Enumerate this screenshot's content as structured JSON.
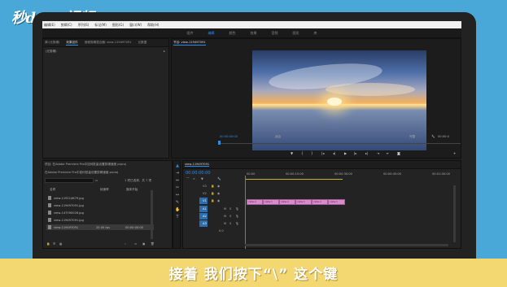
{
  "watermark": {
    "brand": "秒dong视频"
  },
  "menu": [
    "编辑(E)",
    "剪辑(C)",
    "序列(S)",
    "标记(M)",
    "图形(G)",
    "窗口(W)",
    "帮助(H)"
  ],
  "workspaces": [
    {
      "label": "组件",
      "active": false
    },
    {
      "label": "编辑",
      "active": true
    },
    {
      "label": "颜色",
      "active": false
    },
    {
      "label": "效果",
      "active": false
    },
    {
      "label": "音频",
      "active": false
    },
    {
      "label": "图形",
      "active": false
    },
    {
      "label": "库",
      "active": false
    }
  ],
  "source_panel": {
    "tabs": [
      "源:(无剪辑)",
      "效果控件",
      "音频剪辑混合器: view-119497091",
      "元数据"
    ],
    "label": "(无剪辑)"
  },
  "program_panel": {
    "tab": "节目: view-119497091",
    "timecode_left": "00:00:00:00",
    "fit": "适合",
    "quality": "完整",
    "timecode_right": "00:00:0"
  },
  "project_panel": {
    "title": "项目: 在Adobe Premiere Pro中如何批量设置剪辑速度 prproj",
    "path": "在Adobe Premiere Pro中如何批量设置剪辑速度.prproj",
    "count": "1 项已选择，共 7 项",
    "col_name": "名称",
    "col_rate": "帧速率",
    "col_media_start": "媒体开始",
    "files": [
      {
        "name": "view-119214679.jpg",
        "selected": false
      },
      {
        "name": "view-119497091.jpg",
        "selected": false
      },
      {
        "name": "view-147090026.jpg",
        "selected": false
      },
      {
        "name": "view-119497091.jpg",
        "selected": false
      },
      {
        "name": "view-119497091",
        "rate": "25.00 fps",
        "start": "00:00:00:00",
        "selected": true
      }
    ]
  },
  "timeline": {
    "tab": "view-119497091",
    "timecode": "00:00:00:00",
    "ruler": [
      "00:00",
      "00:00:15:00",
      "00:00:30:00",
      "00:00:45:00",
      "00:01:00:00"
    ],
    "tracks_video": [
      "V3",
      "V2",
      "V1"
    ],
    "tracks_audio": [
      "A1",
      "A2",
      "A3"
    ],
    "master": "0.0",
    "clips": [
      "view-1",
      "view-1",
      "view-1",
      "view-1",
      "view-1",
      "view-1"
    ]
  },
  "caption": "接着 我们按下“\\” 这个键",
  "colors": {
    "accent": "#2d8ceb",
    "clip": "#d98ccb",
    "caption_bg": "#f3d770",
    "bg": "#4aa8d8"
  }
}
